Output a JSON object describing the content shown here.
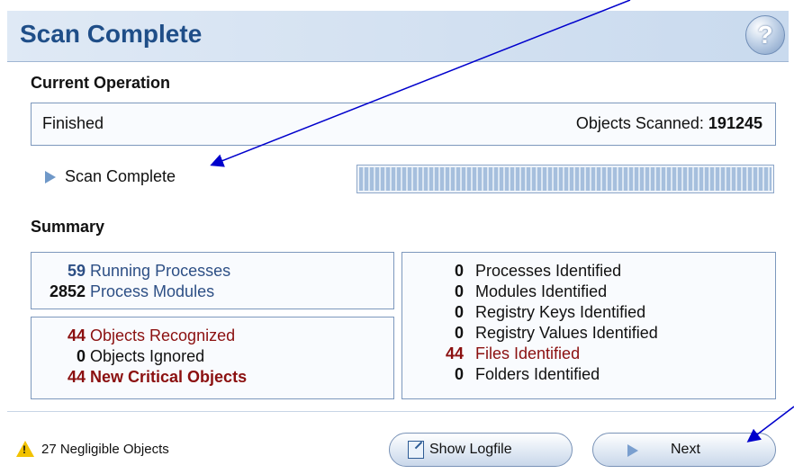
{
  "header": {
    "title": "Scan Complete",
    "help_glyph": "?"
  },
  "current_operation": {
    "section_title": "Current Operation",
    "status": "Finished",
    "objects_scanned_label": "Objects Scanned:",
    "objects_scanned_value": "191245",
    "scan_state": "Scan Complete",
    "progress": 1.0
  },
  "summary": {
    "section_title": "Summary",
    "processes": [
      {
        "count": "59",
        "label": "Running Processes"
      },
      {
        "count": "2852",
        "label": "Process Modules"
      }
    ],
    "objects": [
      {
        "count": "44",
        "label": "Objects Recognized"
      },
      {
        "count": "0",
        "label": "Objects Ignored"
      },
      {
        "count": "44",
        "label": "New Critical Objects"
      }
    ],
    "identified": [
      {
        "count": "0",
        "label": "Processes Identified"
      },
      {
        "count": "0",
        "label": "Modules Identified"
      },
      {
        "count": "0",
        "label": "Registry Keys Identified"
      },
      {
        "count": "0",
        "label": "Registry Values Identified"
      },
      {
        "count": "44",
        "label": "Files Identified"
      },
      {
        "count": "0",
        "label": "Folders Identified"
      }
    ]
  },
  "footer": {
    "warning_text": "27 Negligible Objects",
    "show_logfile_label": "Show Logfile",
    "next_label": "Next"
  },
  "colors": {
    "accent_blue": "#2d4f85",
    "critical_red": "#8b1010",
    "title_blue": "#1f4e88"
  }
}
